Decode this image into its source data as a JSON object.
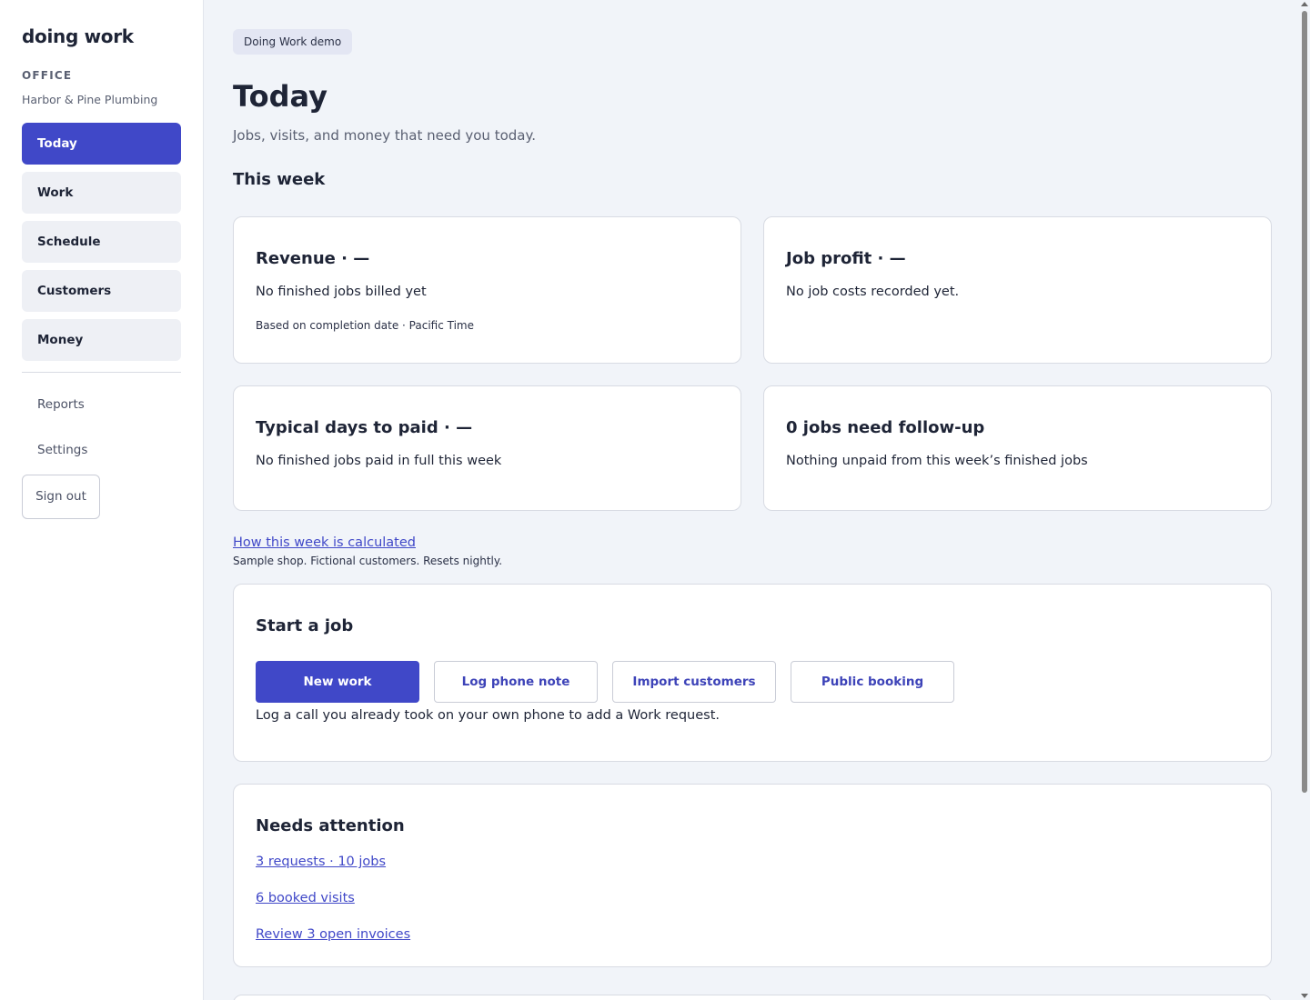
{
  "sidebar": {
    "brand": "doing work",
    "office_label": "OFFICE",
    "office_name": "Harbor & Pine Plumbing",
    "nav": [
      {
        "label": "Today",
        "active": true
      },
      {
        "label": "Work"
      },
      {
        "label": "Schedule"
      },
      {
        "label": "Customers"
      },
      {
        "label": "Money"
      }
    ],
    "secondary": [
      {
        "label": "Reports"
      },
      {
        "label": "Settings"
      }
    ],
    "sign_out": "Sign out"
  },
  "main": {
    "badge": "Doing Work demo",
    "title": "Today",
    "subtitle": "Jobs, visits, and money that need you today.",
    "week_title": "This week",
    "cards": [
      {
        "title": "Revenue · —",
        "text": "No finished jobs billed yet",
        "note": "Based on completion date · Pacific Time"
      },
      {
        "title": "Job profit · —",
        "text": "No job costs recorded yet."
      },
      {
        "title": "Typical days to paid · —",
        "text": "No finished jobs paid in full this week"
      },
      {
        "title": "0 jobs need follow-up",
        "text": "Nothing unpaid from this week’s finished jobs"
      }
    ],
    "calc_link": "How this week is calculated",
    "calc_note": "Sample shop. Fictional customers. Resets nightly.",
    "start_job": {
      "title": "Start a job",
      "buttons": [
        "New work",
        "Log phone note",
        "Import customers",
        "Public booking"
      ],
      "hint": "Log a call you already took on your own phone to add a Work request."
    },
    "attention": {
      "title": "Needs attention",
      "links": [
        "3 requests · 10 jobs",
        "6 booked visits",
        "Review 3 open invoices"
      ]
    }
  },
  "colors": {
    "accent": "#4048c8",
    "background": "#f1f4f9",
    "text": "#1e2436"
  }
}
